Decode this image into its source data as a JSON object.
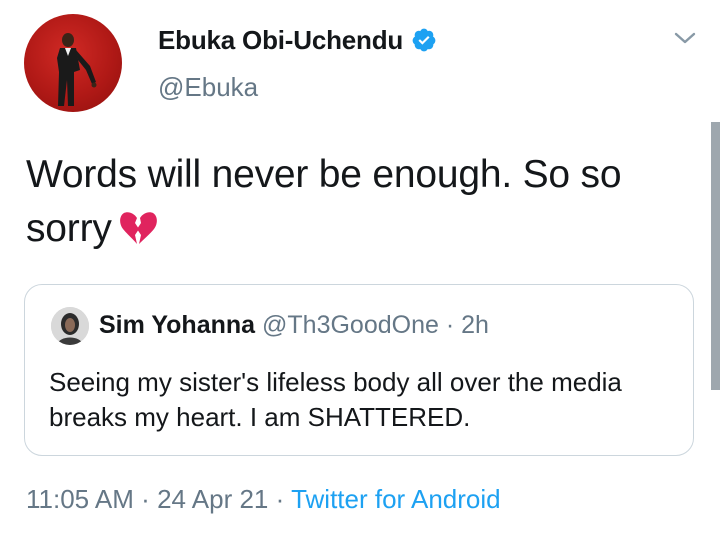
{
  "author": {
    "display_name": "Ebuka Obi-Uchendu",
    "handle": "@Ebuka",
    "verified": true
  },
  "tweet": {
    "text": "Words will never be enough. So so sorry",
    "emoji": "broken-heart"
  },
  "quoted_tweet": {
    "display_name": "Sim Yohanna",
    "handle": "@Th3GoodOne",
    "separator": "·",
    "time": "2h",
    "text": "Seeing my sister's lifeless body all over the media breaks my heart. I am SHATTERED."
  },
  "meta": {
    "time": "11:05 AM",
    "separator1": "·",
    "date": "24 Apr 21",
    "separator2": "·",
    "source": "Twitter for Android"
  },
  "colors": {
    "link": "#1da1f2",
    "secondary_text": "#657786",
    "primary_text": "#14171a",
    "verified_badge": "#1da1f2",
    "broken_heart": "#e0245e"
  },
  "icons": {
    "verified": "verified-badge-icon",
    "menu": "chevron-down-icon",
    "emoji": "broken-heart-emoji-icon"
  }
}
